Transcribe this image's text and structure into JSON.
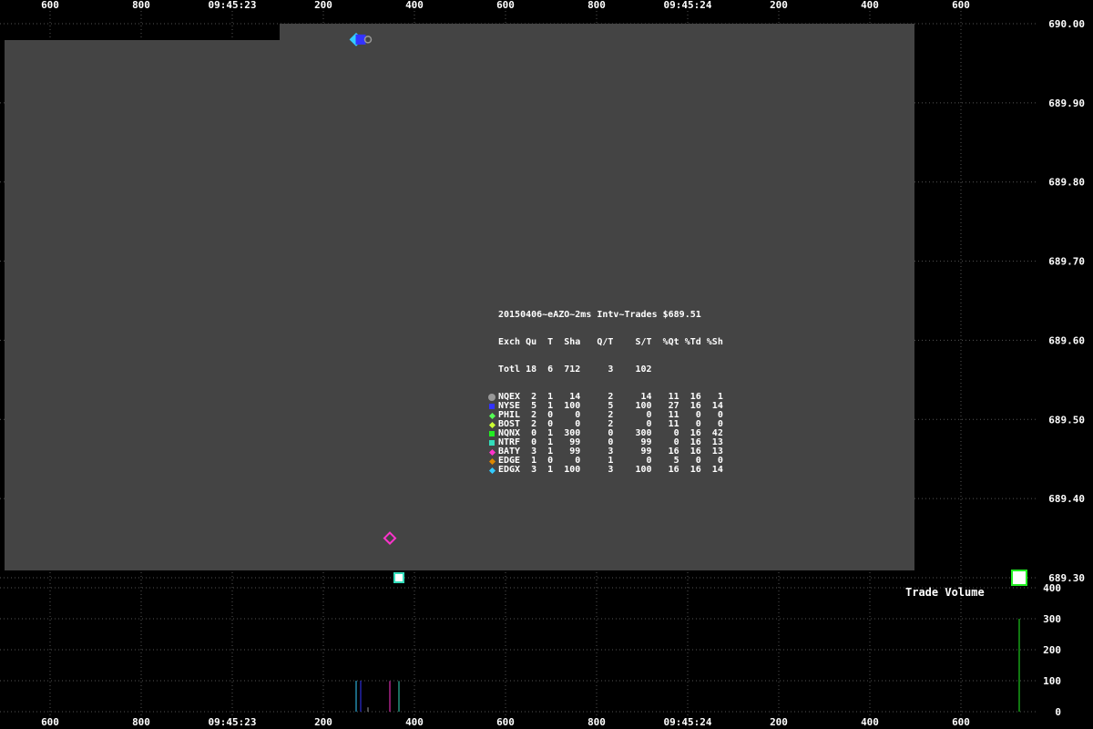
{
  "chart_data": {
    "type": "scatter",
    "title": "20150406~eAZO~2ms Intv~Trades $689.51",
    "top_axis_ticks": [
      "600",
      "800",
      "09:45:23",
      "200",
      "400",
      "600",
      "800",
      "09:45:24",
      "200",
      "400",
      "600"
    ],
    "bottom_axis_ticks": [
      "600",
      "800",
      "09:45:23",
      "200",
      "400",
      "600",
      "800",
      "09:45:24",
      "200",
      "400",
      "600"
    ],
    "price_axis": {
      "ticks": [
        "690.00",
        "689.90",
        "689.80",
        "689.70",
        "689.60",
        "689.50",
        "689.40",
        "689.30"
      ],
      "ylim": [
        689.3,
        690.0
      ]
    },
    "volume_axis": {
      "label": "Trade Volume",
      "ticks": [
        "400",
        "300",
        "200",
        "100",
        "0"
      ],
      "ylim": [
        0,
        400
      ]
    },
    "points": [
      {
        "exchange": "EDGX",
        "price": 689.98,
        "time_ms": 272,
        "shape": "diamond",
        "color": "#33ccff"
      },
      {
        "exchange": "NYSE",
        "price": 689.98,
        "time_ms": 282,
        "shape": "square",
        "color": "#3333ff"
      },
      {
        "exchange": "NQEX",
        "price": 689.98,
        "time_ms": 298,
        "shape": "circle",
        "color": "#999999"
      },
      {
        "exchange": "BATY",
        "price": 689.35,
        "time_ms": 346,
        "shape": "diamond",
        "color": "#ff33cc"
      },
      {
        "exchange": "NTRF",
        "price": 689.3,
        "time_ms": 366,
        "shape": "square",
        "color": "#33ddbb"
      },
      {
        "exchange": "NQNX",
        "price": 689.3,
        "time_ms": 1728,
        "shape": "square",
        "color": "#22ee22"
      }
    ],
    "volume_bars": [
      {
        "time_ms": 272,
        "volume": 100,
        "color": "#33ccff"
      },
      {
        "time_ms": 282,
        "volume": 100,
        "color": "#3333ff"
      },
      {
        "time_ms": 298,
        "volume": 14,
        "color": "#999999"
      },
      {
        "time_ms": 346,
        "volume": 99,
        "color": "#ff33cc"
      },
      {
        "time_ms": 366,
        "volume": 99,
        "color": "#33ddbb"
      },
      {
        "time_ms": 1728,
        "volume": 300,
        "color": "#22ee22"
      }
    ],
    "grid": true
  },
  "stats": {
    "title": "20150406~eAZO~2ms Intv~Trades $689.51",
    "header": "Exch Qu  T  Sha   Q/T    S/T  %Qt %Td %Sh",
    "total": "Totl 18  6  712     3    102",
    "rows": [
      {
        "marker": "circle",
        "color": "#999999",
        "text": "NQEX  2  1   14     2     14   11  16   1"
      },
      {
        "marker": "square",
        "color": "#3333ff",
        "text": "NYSE  5  1  100     5    100   27  16  14"
      },
      {
        "marker": "diamond",
        "color": "#55ff55",
        "text": "PHIL  2  0    0     2      0   11   0   0"
      },
      {
        "marker": "diamond",
        "color": "#ccff33",
        "text": "BOST  2  0    0     2      0   11   0   0"
      },
      {
        "marker": "square",
        "color": "#22ee22",
        "text": "NQNX  0  1  300     0    300    0  16  42"
      },
      {
        "marker": "square",
        "color": "#33ddbb",
        "text": "NTRF  0  1   99     0     99    0  16  13"
      },
      {
        "marker": "diamond",
        "color": "#ff33cc",
        "text": "BATY  3  1   99     3     99   16  16  13"
      },
      {
        "marker": "diamond",
        "color": "#dd8800",
        "text": "EDGE  1  0    0     1      0    5   0   0"
      },
      {
        "marker": "diamond",
        "color": "#33ccff",
        "text": "EDGX  3  1  100     3    100   16  16  14"
      }
    ]
  }
}
